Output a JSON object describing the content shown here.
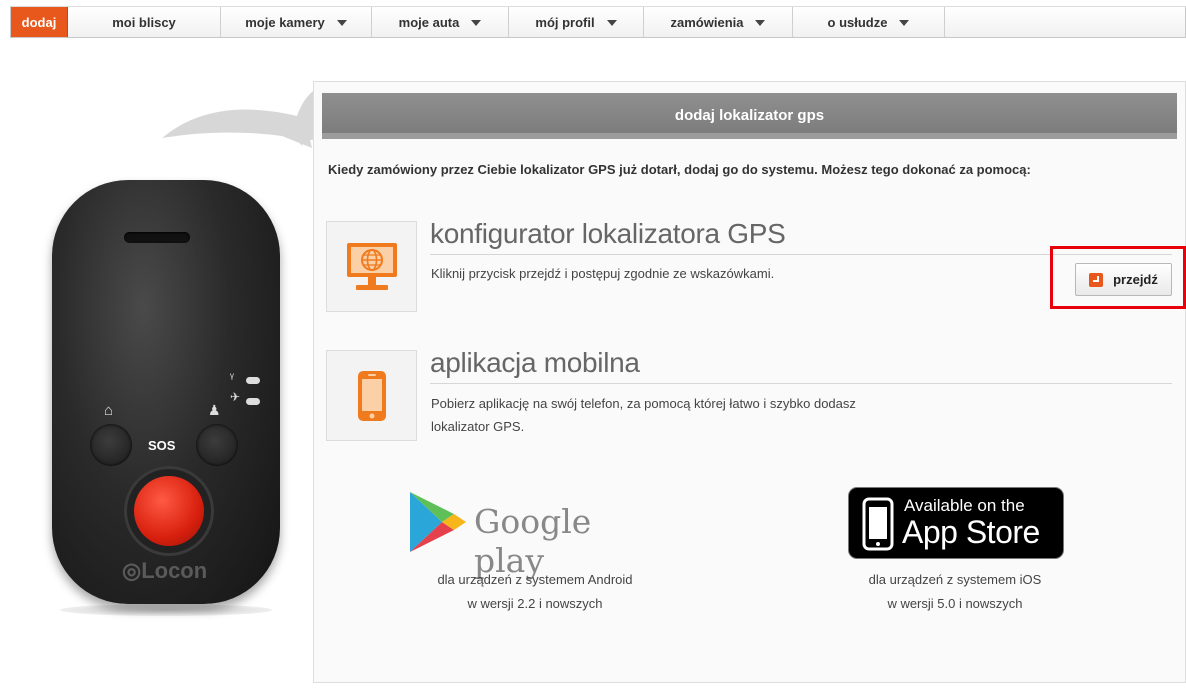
{
  "nav": {
    "items": [
      {
        "label": "dodaj",
        "active": true,
        "dropdown": false
      },
      {
        "label": "moi bliscy",
        "active": false,
        "dropdown": false
      },
      {
        "label": "moje kamery",
        "active": false,
        "dropdown": true
      },
      {
        "label": "moje auta",
        "active": false,
        "dropdown": true
      },
      {
        "label": "mój profil",
        "active": false,
        "dropdown": true
      },
      {
        "label": "zamówienia",
        "active": false,
        "dropdown": true
      },
      {
        "label": "o usłudze",
        "active": false,
        "dropdown": true
      }
    ]
  },
  "device": {
    "sos_label": "SOS",
    "brand": "◎Locon"
  },
  "panel": {
    "header": "dodaj lokalizator gps",
    "intro": "Kiedy zamówiony przez Ciebie lokalizator GPS już dotarł, dodaj go do systemu. Możesz tego dokonać za pomocą:",
    "configurator": {
      "title": "konfigurator lokalizatora GPS",
      "description": "Kliknij przycisk przejdź i postępuj zgodnie ze wskazówkami.",
      "button_label": "przejdź",
      "icon": "computer-globe-icon"
    },
    "mobile": {
      "title": "aplikacja mobilna",
      "description_line1": "Pobierz aplikację na swój telefon, za pomocą której łatwo i szybko dodasz",
      "description_line2": "lokalizator GPS.",
      "icon": "smartphone-icon"
    },
    "google_play": {
      "label": "Google play",
      "caption_line1": "dla urządzeń z systemem Android",
      "caption_line2": "w wersji 2.2 i nowszych"
    },
    "app_store": {
      "label_line1": "Available on the",
      "label_line2": "App Store",
      "caption_line1": "dla urządzeń z systemem iOS",
      "caption_line2": "w wersji 5.0 i nowszych"
    }
  },
  "colors": {
    "accent": "#e8581c",
    "highlight": "#e8000b",
    "header_bg": "#858585"
  }
}
